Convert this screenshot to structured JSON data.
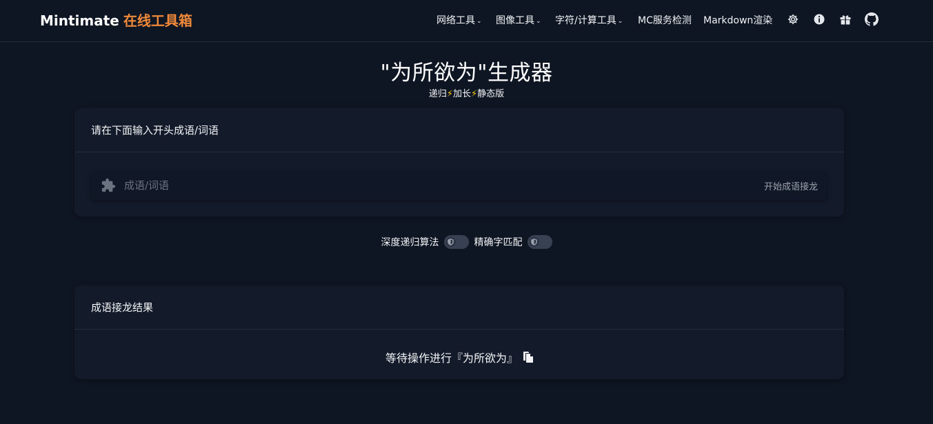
{
  "brand": {
    "name": "Mintimate",
    "suffix": "在线工具箱"
  },
  "nav": {
    "items": [
      {
        "label": "网络工具",
        "chevron": "⌄"
      },
      {
        "label": "图像工具",
        "chevron": "⌄"
      },
      {
        "label": "字符/计算工具",
        "chevron": "⌄"
      },
      {
        "label": "MC服务检测"
      },
      {
        "label": "Markdown渲染"
      }
    ],
    "icons": [
      "gear-icon",
      "info-icon",
      "gift-icon",
      "github-icon"
    ]
  },
  "page": {
    "title": "\"为所欲为\"生成器",
    "subtitle": {
      "part1": "递归",
      "bolt": "⚡",
      "part2": "加长",
      "part3": "静态版"
    }
  },
  "input_card": {
    "heading": "请在下面输入开头成语/词语",
    "placeholder": "成语/词语",
    "value": "",
    "start_label": "开始成语接龙"
  },
  "toggles": [
    {
      "label": "深度递归算法",
      "on": false
    },
    {
      "label": "精确字匹配",
      "on": false
    }
  ],
  "result_card": {
    "heading": "成语接龙结果",
    "text": "等待操作进行『为所欲为』"
  },
  "colors": {
    "background": "#0f1623",
    "card": "#131b2b",
    "brand_accent": "#f08a3a",
    "bolt": "#facc15"
  }
}
